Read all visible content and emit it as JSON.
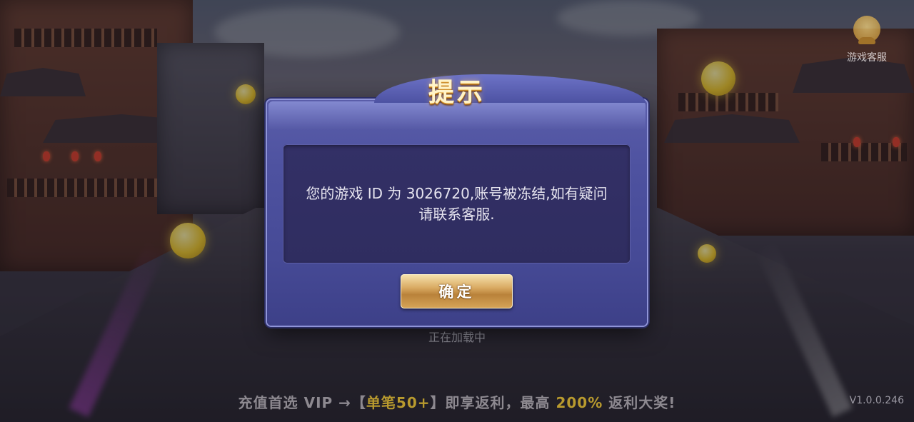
{
  "background": {
    "loading_text": "正在加载中",
    "customer_service_label": "游戏客服",
    "promo": {
      "part1": "充值首选 VIP →【",
      "part2": "单笔50+",
      "part3": "】即享返利，最高",
      "part4": "200%",
      "part5": "返利大奖!"
    },
    "version": "V1.0.0.246"
  },
  "dialog": {
    "title": "提示",
    "message_line1": "您的游戏 ID 为 3026720,账号被冻结,如有疑问",
    "message_line2": "请联系客服.",
    "confirm_label": "确定"
  },
  "colors": {
    "dialog_bg": "#4e52a0",
    "message_bg": "#333066",
    "button_gold": "#d9aa62",
    "title_cream": "#fff3c8"
  }
}
